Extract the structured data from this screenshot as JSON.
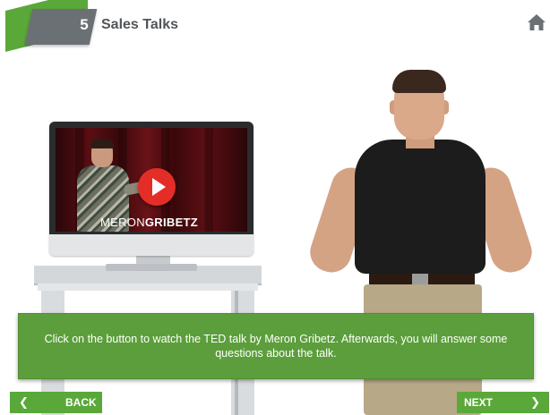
{
  "header": {
    "chapter_number": "5",
    "title": "Sales Talks",
    "home_icon": "home-icon"
  },
  "video": {
    "caption_first": "MERON",
    "caption_last": "GRIBETZ",
    "play_icon": "play-icon",
    "play_color": "#e52d27"
  },
  "instruction": {
    "text": "Click on the button to watch the TED talk by Meron Gribetz. Afterwards, you will answer some questions about the talk."
  },
  "nav": {
    "back_label": "BACK",
    "back_icon": "chevron-left-icon",
    "next_label": "NEXT",
    "next_icon": "chevron-right-icon"
  },
  "colors": {
    "accent_green": "#5aa83a",
    "header_gray": "#6b7075",
    "title_text": "#505559"
  }
}
